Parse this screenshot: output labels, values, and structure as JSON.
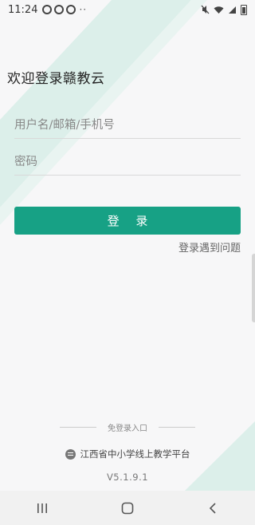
{
  "status_bar": {
    "time": "11:24",
    "dots": "··"
  },
  "login": {
    "welcome_title": "欢迎登录赣教云",
    "username_placeholder": "用户名/邮箱/手机号",
    "password_placeholder": "密码",
    "login_button": "登 录",
    "help_link": "登录遇到问题"
  },
  "footer": {
    "free_login_entry": "免登录入口",
    "platform_name": "江西省中小学线上教学平台",
    "version": "V5.1.9.1"
  },
  "colors": {
    "accent": "#17a185",
    "background": "#f7f7f8",
    "decor": "#dff0ec"
  },
  "icons": {
    "platform_logo": "platform-logo-icon",
    "nav_recent": "recent-apps-icon",
    "nav_home": "home-icon",
    "nav_back": "back-icon"
  }
}
